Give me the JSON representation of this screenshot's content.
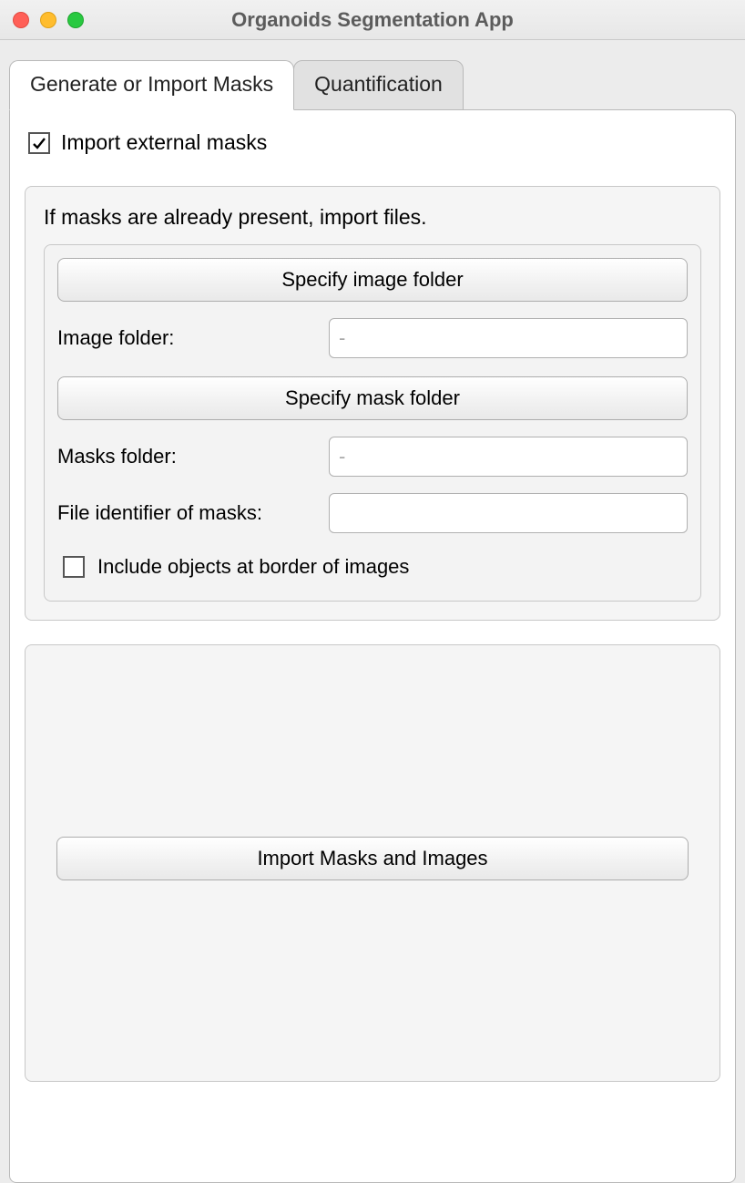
{
  "window": {
    "title": "Organoids Segmentation App"
  },
  "tabs": {
    "generate": "Generate or Import Masks",
    "quantification": "Quantification"
  },
  "checkbox": {
    "import_external": "Import external masks"
  },
  "group1": {
    "heading": "If masks are already present, import files.",
    "specify_image_btn": "Specify image folder",
    "image_folder_label": "Image folder:",
    "image_folder_value": "",
    "image_folder_placeholder": "-",
    "specify_mask_btn": "Specify mask folder",
    "masks_folder_label": "Masks folder:",
    "masks_folder_value": "",
    "masks_folder_placeholder": "-",
    "file_identifier_label": "File identifier of masks:",
    "file_identifier_value": "",
    "include_border_label": "Include objects at border of images"
  },
  "group2": {
    "import_btn": "Import Masks and Images"
  }
}
